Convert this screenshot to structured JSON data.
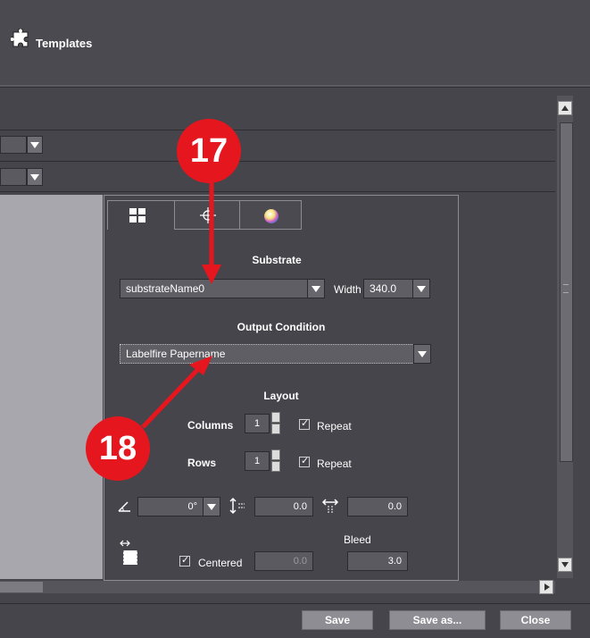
{
  "window": {
    "title": "Templates"
  },
  "tabs": [
    {
      "icon": "grid-layout-icon"
    },
    {
      "icon": "crosshair-icon"
    },
    {
      "icon": "color-wheel-icon"
    }
  ],
  "substrate": {
    "title": "Substrate",
    "name": "substrateName0",
    "width_label": "Width",
    "width_value": "340.0"
  },
  "output": {
    "title": "Output Condition",
    "value": "Labelfire Papername"
  },
  "layout": {
    "title": "Layout",
    "columns_label": "Columns",
    "columns_value": "1",
    "columns_repeat": "Repeat",
    "rows_label": "Rows",
    "rows_value": "1",
    "rows_repeat": "Repeat"
  },
  "placement": {
    "angle": "0°",
    "vspacing": "0.0",
    "hspacing": "0.0"
  },
  "bleed": {
    "title": "Bleed",
    "centered_label": "Centered",
    "centered_value": "0.0",
    "value": "3.0"
  },
  "buttons": {
    "save": "Save",
    "save_as": "Save as...",
    "close": "Close"
  },
  "markers": {
    "m17": "17",
    "m18": "18"
  },
  "colors": {
    "marker": "#e5161e",
    "background": "#45454b"
  }
}
